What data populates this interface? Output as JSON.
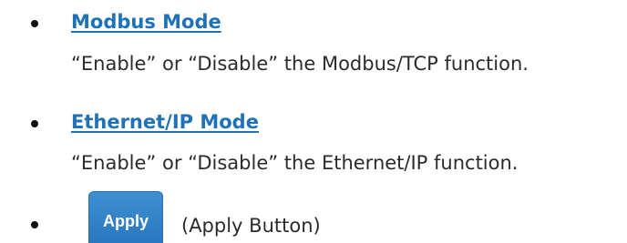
{
  "items": [
    {
      "heading": "Modbus Mode",
      "description": "“Enable” or “Disable” the Modbus/TCP function."
    },
    {
      "heading": "Ethernet/IP Mode",
      "description": "“Enable” or “Disable” the Ethernet/IP function."
    }
  ],
  "apply": {
    "button_label": "Apply",
    "note": "(Apply Button)"
  },
  "colors": {
    "heading_link": "#1f72b8",
    "button_bg": "#2a78c0"
  }
}
